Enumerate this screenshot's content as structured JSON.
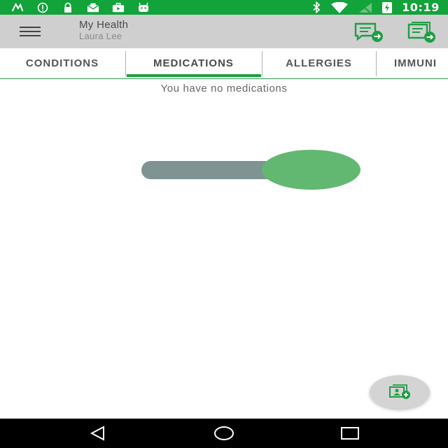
{
  "status_bar": {
    "time": "10:19",
    "left_icons": [
      "signal-app-icon",
      "info-icon",
      "lock-icon",
      "mail-icon",
      "briefcase-icon",
      "android-icon"
    ],
    "right_icons": [
      "bluetooth-icon",
      "wifi-icon",
      "no-signal-icon",
      "battery-charging-icon"
    ]
  },
  "app_bar": {
    "title": "My Health",
    "subtitle": "Laura Lee",
    "actions": [
      "message-forward-icon",
      "records-forward-icon"
    ]
  },
  "tabs": [
    {
      "label": "CONDITIONS",
      "selected": false
    },
    {
      "label": "MEDICATIONS",
      "selected": true
    },
    {
      "label": "ALLERGIES",
      "selected": false
    },
    {
      "label": "IMMUNI",
      "selected": false
    }
  ],
  "content": {
    "empty_message": "You have no medications",
    "toggle_on": true
  },
  "fab": {
    "icon": "add-record-icon"
  },
  "nav_bar": {
    "buttons": [
      "back-icon",
      "home-icon",
      "recents-icon"
    ]
  },
  "colors": {
    "status_bar": "#12a33a",
    "app_bar": "#cfcfcf",
    "accent": "#1e9e44",
    "toggle_thumb": "#62b870",
    "toggle_track": "#7f9393"
  }
}
